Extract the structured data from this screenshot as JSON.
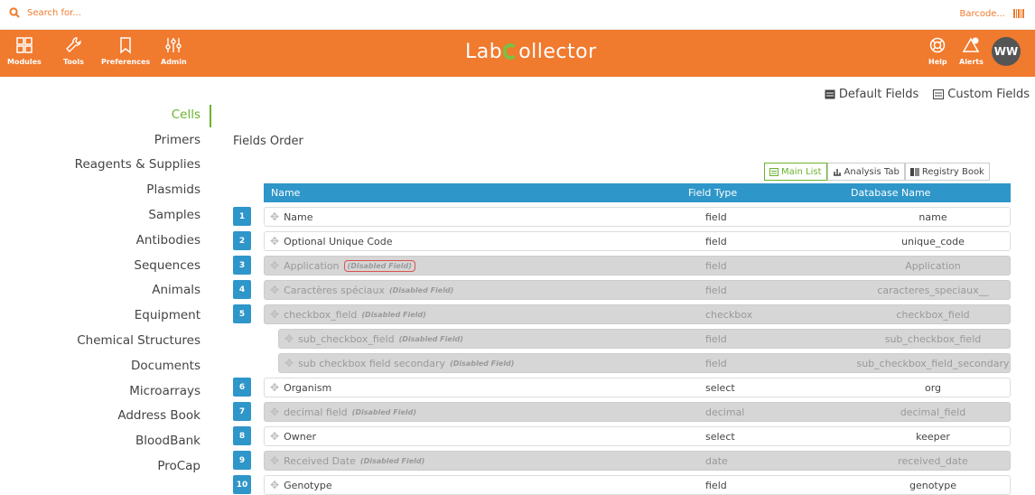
{
  "search": {
    "placeholder": "Search for..."
  },
  "barcode": {
    "label": "Barcode..."
  },
  "nav": {
    "items": [
      {
        "label": "Modules"
      },
      {
        "label": "Tools"
      },
      {
        "label": "Preferences"
      },
      {
        "label": "Admin"
      }
    ],
    "logo_left": "Lab",
    "logo_right": "ollector",
    "help": "Help",
    "alerts": "Alerts",
    "avatar": "WW"
  },
  "colors": {
    "brand": "#f07a2e",
    "accent": "#6ab42d",
    "header": "#2e96c9"
  },
  "field_tabs": {
    "default": "Default Fields",
    "custom": "Custom Fields"
  },
  "sidebar": {
    "items": [
      {
        "label": "Cells"
      },
      {
        "label": "Primers"
      },
      {
        "label": "Reagents & Supplies"
      },
      {
        "label": "Plasmids"
      },
      {
        "label": "Samples"
      },
      {
        "label": "Antibodies"
      },
      {
        "label": "Sequences"
      },
      {
        "label": "Animals"
      },
      {
        "label": "Equipment"
      },
      {
        "label": "Chemical Structures"
      },
      {
        "label": "Documents"
      },
      {
        "label": "Microarrays"
      },
      {
        "label": "Address Book"
      },
      {
        "label": "BloodBank"
      },
      {
        "label": "ProCap"
      }
    ]
  },
  "main": {
    "title": "Fields Order",
    "view_tabs": [
      "Main List",
      "Analysis Tab",
      "Registry Book"
    ],
    "columns": {
      "name": "Name",
      "type": "Field Type",
      "db": "Database Name"
    },
    "disabled_tag": "(Disabled Field)",
    "rows": [
      {
        "num": "1",
        "name": "Name",
        "type": "field",
        "db": "name"
      },
      {
        "num": "2",
        "name": "Optional Unique Code",
        "type": "field",
        "db": "unique_code"
      },
      {
        "num": "3",
        "name": "Application",
        "type": "field",
        "db": "Application",
        "disabled": true
      },
      {
        "num": "4",
        "name": "Caractères spéciaux",
        "type": "field",
        "db": "caracteres_speciaux__",
        "disabled": true
      },
      {
        "num": "5",
        "name": "checkbox_field",
        "type": "checkbox",
        "db": "checkbox_field",
        "disabled": true
      },
      {
        "num": "",
        "name": "sub_checkbox_field",
        "type": "field",
        "db": "sub_checkbox_field",
        "disabled": true
      },
      {
        "num": "",
        "name": "sub checkbox field secondary",
        "type": "field",
        "db": "sub_checkbox_field_secondary",
        "disabled": true
      },
      {
        "num": "6",
        "name": "Organism",
        "type": "select",
        "db": "org"
      },
      {
        "num": "7",
        "name": "decimal field",
        "type": "decimal",
        "db": "decimal_field",
        "disabled": true
      },
      {
        "num": "8",
        "name": "Owner",
        "type": "select",
        "db": "keeper"
      },
      {
        "num": "9",
        "name": "Received Date",
        "type": "date",
        "db": "received_date",
        "disabled": true
      },
      {
        "num": "10",
        "name": "Genotype",
        "type": "field",
        "db": "genotype"
      }
    ]
  }
}
